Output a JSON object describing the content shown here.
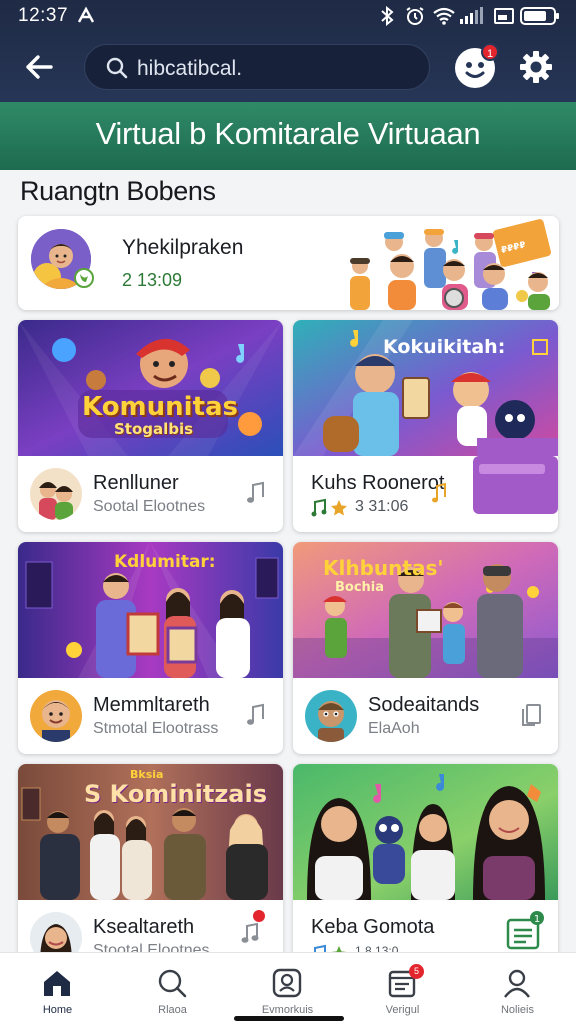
{
  "status_bar": {
    "time": "12:37"
  },
  "header": {
    "search_value": "hibcatibcal.",
    "notification_count": "1"
  },
  "banner": {
    "title": "Virtual b Komitarale Virtuaan"
  },
  "section": {
    "title": "Ruangtn Bobens"
  },
  "featured": {
    "name": "Yhekilpraken",
    "meta": "2 13:09"
  },
  "cards": [
    {
      "image_title": "Komunitas",
      "image_subtitle": "Stogalbis",
      "name": "Renlluner",
      "subtitle": "Sootal Elootnes",
      "icon": "music-note-icon"
    },
    {
      "image_title": "Kokuikitah:",
      "image_subtitle": "",
      "name": "Kuhs Roonerot",
      "subtitle": "3 31:06",
      "icon": "music-note-icon"
    },
    {
      "image_title": "Kdlumitar:",
      "image_subtitle": "",
      "name": "Memmltareth",
      "subtitle": "Stmotal Elootrass",
      "icon": "music-note-icon"
    },
    {
      "image_title": "Klhbuntas'",
      "image_subtitle": "Bochia",
      "name": "Sodeaitands",
      "subtitle": "ElaAoh",
      "icon": "copy-icon"
    },
    {
      "image_title": "S Kominitzais",
      "image_subtitle": "Bksia",
      "name": "Ksealtareth",
      "subtitle": "Stootal Elootnes",
      "icon": "music-note-icon",
      "badge": ""
    },
    {
      "image_title": "",
      "image_subtitle": "",
      "name": "Keba Gomota",
      "subtitle": "1.8 13:0",
      "icon": "list-icon",
      "badge": "1"
    }
  ],
  "bottom_nav": [
    {
      "label": "Home",
      "icon": "home-icon",
      "active": true
    },
    {
      "label": "Rlaoa",
      "icon": "search-icon"
    },
    {
      "label": "Evmorkuis",
      "icon": "profile-card-icon"
    },
    {
      "label": "Verigul",
      "icon": "calendar-icon",
      "badge": "5"
    },
    {
      "label": "Nolieis",
      "icon": "user-icon"
    }
  ],
  "colors": {
    "header_bg": "#1f2a45",
    "banner_bg": "#2f8a67",
    "badge_red": "#e3262e",
    "accent_green": "#2d7a37"
  }
}
